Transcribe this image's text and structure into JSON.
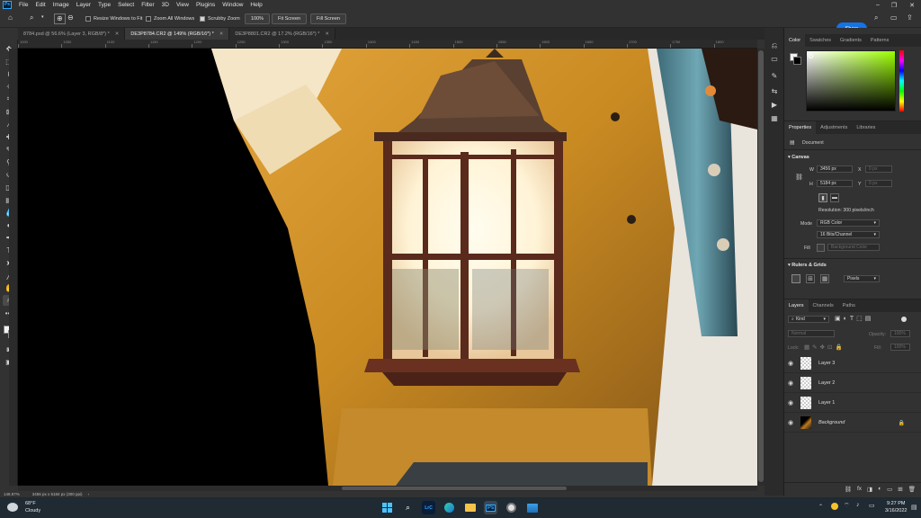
{
  "app": {
    "logo": "Ps",
    "menus": [
      "File",
      "Edit",
      "Image",
      "Layer",
      "Type",
      "Select",
      "Filter",
      "3D",
      "View",
      "Plugins",
      "Window",
      "Help"
    ]
  },
  "options": {
    "resize_windows": "Resize Windows to Fit",
    "zoom_all": "Zoom All Windows",
    "scrubby_zoom": "Scrubby Zoom",
    "zoom_100": "100%",
    "fit_screen": "Fit Screen",
    "fill_screen": "Fill Screen",
    "share": "Share"
  },
  "tabs": [
    {
      "label": "8784.psd @ 56.6% (Layer 3, RGB/8*) *"
    },
    {
      "label": "DE3P8784.CR2 @ 149% (RGB/16*) *"
    },
    {
      "label": "DE3P8801.CR2 @ 17.2% (RGB/16*) *"
    }
  ],
  "ruler": {
    "h_ticks": [
      "1000",
      "1050",
      "1100",
      "1150",
      "1200",
      "1250",
      "1300",
      "1350",
      "1400",
      "1450",
      "1500",
      "1550",
      "1600",
      "1650",
      "1700",
      "1750",
      "1800"
    ]
  },
  "status": {
    "zoom": "148.87%",
    "doc_size": "3456 px x 5184 px (300 ppi)"
  },
  "color_panel": {
    "tabs": [
      "Color",
      "Swatches",
      "Gradients",
      "Patterns"
    ],
    "hue": "#9cff00"
  },
  "properties": {
    "tabs": [
      "Properties",
      "Adjustments",
      "Libraries"
    ],
    "kind": "Document",
    "canvas_header": "Canvas",
    "w_label": "W",
    "w_value": "3456 px",
    "x_label": "X",
    "x_value": "0 px",
    "h_label": "H",
    "h_value": "5184 px",
    "y_label": "Y",
    "y_value": "0 px",
    "resolution": "Resolution: 300 pixels/inch",
    "mode_label": "Mode",
    "mode_value": "RGB Color",
    "bits_value": "16 Bits/Channel",
    "fill_label": "Fill",
    "fill_value": "Background Color",
    "rulers_header": "Rulers & Grids",
    "units_value": "Pixels"
  },
  "layers_panel": {
    "tabs": [
      "Layers",
      "Channels",
      "Paths"
    ],
    "kind_filter": "Kind",
    "blend_mode": "Normal",
    "opacity_label": "Opacity:",
    "opacity_value": "100%",
    "lock_label": "Lock:",
    "fill_label": "Fill:",
    "fill_value": "100%",
    "layers": [
      {
        "name": "Layer 3"
      },
      {
        "name": "Layer 2"
      },
      {
        "name": "Layer 1"
      },
      {
        "name": "Background"
      }
    ]
  },
  "taskbar": {
    "temperature": "68°F",
    "condition": "Cloudy",
    "time": "9:27 PM",
    "date": "3/16/2022"
  }
}
